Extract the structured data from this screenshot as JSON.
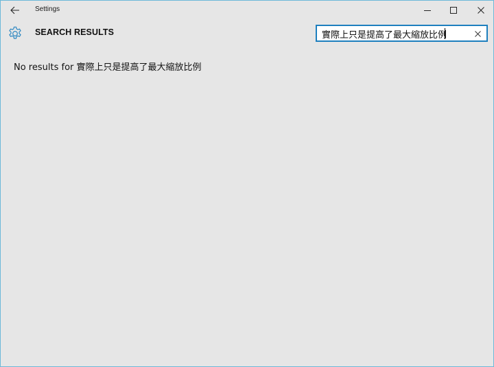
{
  "window": {
    "title": "Settings",
    "accent_color": "#1d7fbe"
  },
  "header": {
    "title": "SEARCH RESULTS",
    "icon": "gear-icon"
  },
  "search": {
    "value": "實際上只是提高了最大縮放比例",
    "placeholder": ""
  },
  "results": {
    "message": "No results for 實際上只是提高了最大縮放比例"
  }
}
